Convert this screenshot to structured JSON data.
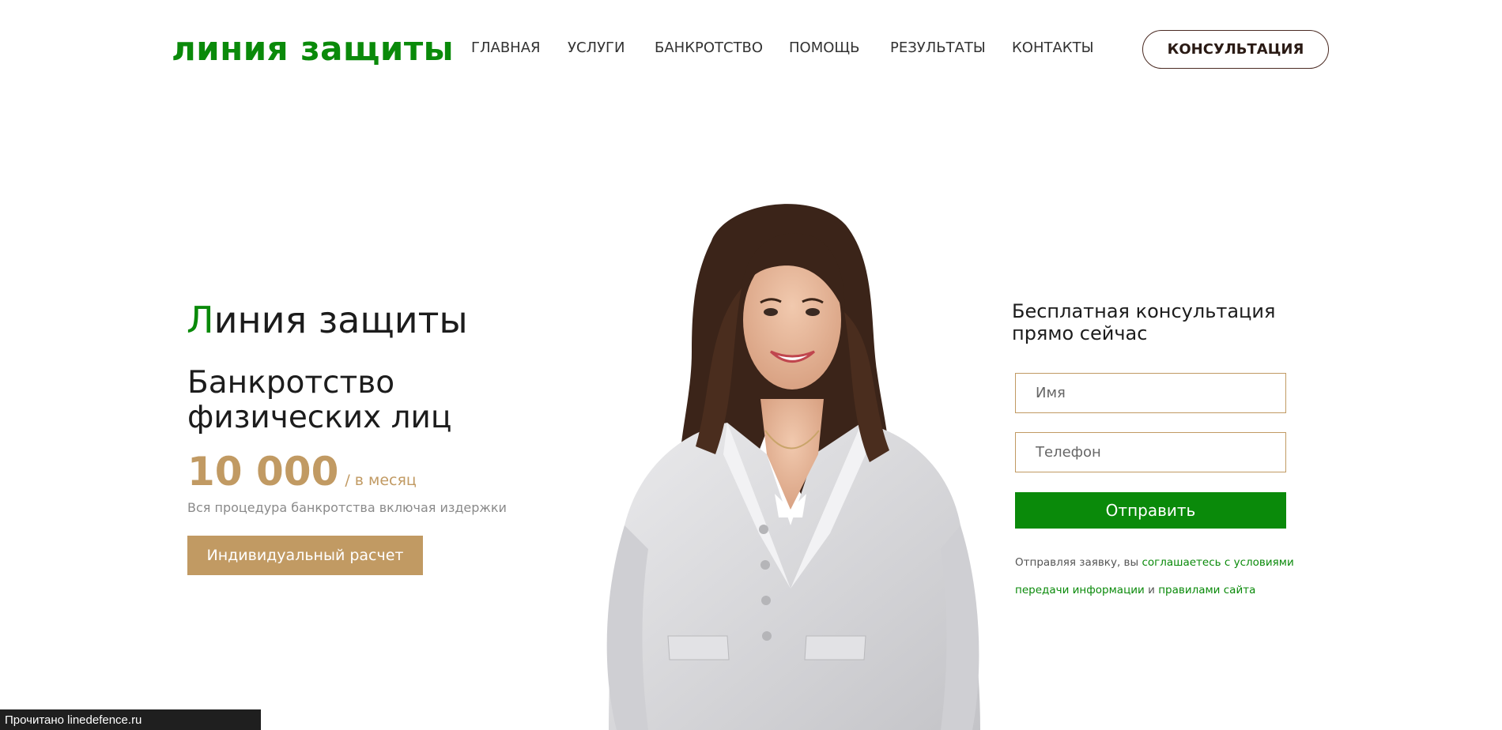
{
  "header": {
    "logo": "линия защиты",
    "nav": [
      "ГЛАВНАЯ",
      "УСЛУГИ",
      "БАНКРОТСТВО",
      "ПОМОЩЬ",
      "РЕЗУЛЬТАТЫ",
      "КОНТАКТЫ"
    ],
    "consult_button": "КОНСУЛЬТАЦИЯ"
  },
  "hero": {
    "title_first_letter": "Л",
    "title_rest": "иния защиты",
    "subtitle": "Банкротство физических лиц",
    "price": "10 000",
    "price_unit": "/ в месяц",
    "price_note": "Вся процедура банкротства включая издержки",
    "calc_button": "Индивидуальный расчет"
  },
  "form": {
    "title": "Бесплатная консультация прямо сейчас",
    "name_placeholder": "Имя",
    "phone_placeholder": "Телефон",
    "submit": "Отправить",
    "legal_prefix": "Отправляя заявку, вы",
    "legal_link1": "соглашаетесь с условиями передачи информации",
    "legal_and": "и",
    "legal_link2": "правилами сайта"
  },
  "statusbar": {
    "text": "Прочитано linedefence.ru"
  },
  "colors": {
    "brand_green": "#0a8a0a",
    "gold": "#c19a63",
    "dark_border": "#4a2a22"
  }
}
